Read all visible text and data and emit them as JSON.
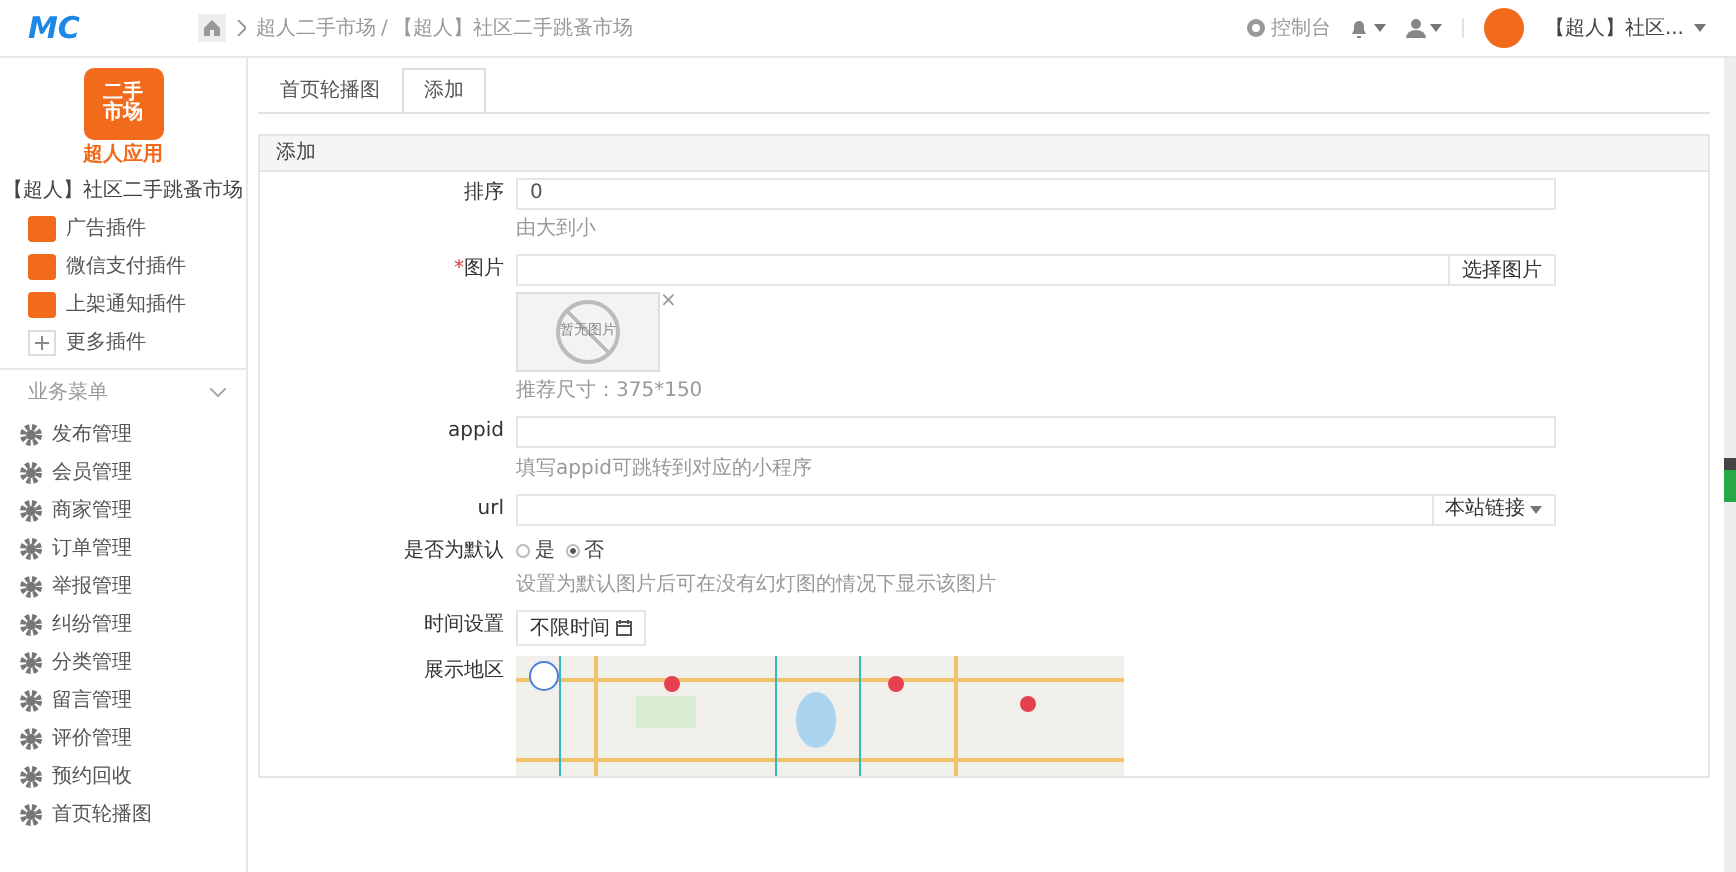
{
  "header": {
    "logo": "MC",
    "breadcrumb": [
      "超人二手市场",
      "【超人】社区二手跳蚤市场"
    ],
    "breadcrumb_separator": "/",
    "console": "控制台",
    "account": "【超人】社区..."
  },
  "sidebar": {
    "app_logo": {
      "line_1": "二手",
      "line_2": "市场",
      "caption": "超人应用"
    },
    "app_name": "【超人】社区二手跳蚤市场",
    "plugins": [
      {
        "label": "广告插件",
        "kind": "plugin"
      },
      {
        "label": "微信支付插件",
        "kind": "plugin"
      },
      {
        "label": "上架通知插件",
        "kind": "plugin"
      },
      {
        "label": "更多插件",
        "kind": "more"
      }
    ],
    "section_title": "业务菜单",
    "expanded": true,
    "items": [
      {
        "label": "发布管理"
      },
      {
        "label": "会员管理"
      },
      {
        "label": "商家管理"
      },
      {
        "label": "订单管理"
      },
      {
        "label": "举报管理"
      },
      {
        "label": "纠纷管理"
      },
      {
        "label": "分类管理"
      },
      {
        "label": "留言管理"
      },
      {
        "label": "评价管理"
      },
      {
        "label": "预约回收"
      },
      {
        "label": "首页轮播图"
      }
    ]
  },
  "tabs": [
    {
      "label": "首页轮播图",
      "selected": false
    },
    {
      "label": "添加",
      "selected": true
    }
  ],
  "panel": {
    "title": "添加",
    "fields": [
      {
        "kind": "text",
        "label": "排序",
        "value": "0",
        "help": "由大到小"
      },
      {
        "kind": "image",
        "label": "图片",
        "required_mark": "*",
        "button": "选择图片",
        "empty_image": "暂无图片",
        "remove": "×",
        "help": "推荐尺寸：375*150"
      },
      {
        "kind": "text",
        "label": "appid",
        "help": "填写appid可跳转到对应的小程序"
      },
      {
        "kind": "link",
        "label": "url",
        "button": "本站链接"
      },
      {
        "kind": "radio",
        "label": "是否为默认",
        "options": [
          {
            "label": "是",
            "selected": false
          },
          {
            "label": "否",
            "selected": true
          }
        ],
        "help": "设置为默认图片后可在没有幻灯图的情况下显示该图片"
      },
      {
        "kind": "time",
        "label": "时间设置",
        "button": "不限时间"
      },
      {
        "kind": "map",
        "label": "展示地区"
      }
    ]
  }
}
